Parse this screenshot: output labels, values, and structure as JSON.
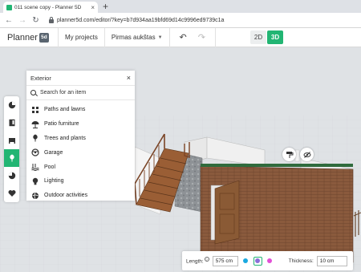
{
  "browser": {
    "tab_title": "011 scene copy - Planner 5D",
    "tab_close": "×",
    "new_tab": "+",
    "url": "planner5d.com/editor/?key=b7d934aa19bfd69d14c9996ed9739c1a"
  },
  "header": {
    "logo_text": "Planner",
    "logo_badge": "5d",
    "my_projects": "My projects",
    "floor_selector": "Pirmas aukštas",
    "view_2d": "2D",
    "view_3d": "3D"
  },
  "catalog": {
    "title": "Exterior",
    "close": "×",
    "search_placeholder": "Search for an item",
    "items": [
      {
        "label": "Paths and lawns",
        "icon": "paths-icon"
      },
      {
        "label": "Patio furniture",
        "icon": "umbrella-icon"
      },
      {
        "label": "Trees and plants",
        "icon": "tree-icon"
      },
      {
        "label": "Garage",
        "icon": "car-icon"
      },
      {
        "label": "Pool",
        "icon": "pool-icon"
      },
      {
        "label": "Lighting",
        "icon": "bulb-icon"
      },
      {
        "label": "Outdoor activities",
        "icon": "activity-icon"
      }
    ]
  },
  "toolbar": {
    "items": [
      "room-icon",
      "door-window-icon",
      "furniture-icon",
      "exterior-icon",
      "decor-icon",
      "favorites-icon"
    ],
    "active": "exterior-icon"
  },
  "dimensions": {
    "length_label": "Length:",
    "length_value": "575 cm",
    "thickness_label": "Thickness:",
    "thickness_value": "10 cm"
  },
  "colors": {
    "accent": "#22b573",
    "wall_brick": "#8b5a3c",
    "sky": "#dfe2e5"
  }
}
